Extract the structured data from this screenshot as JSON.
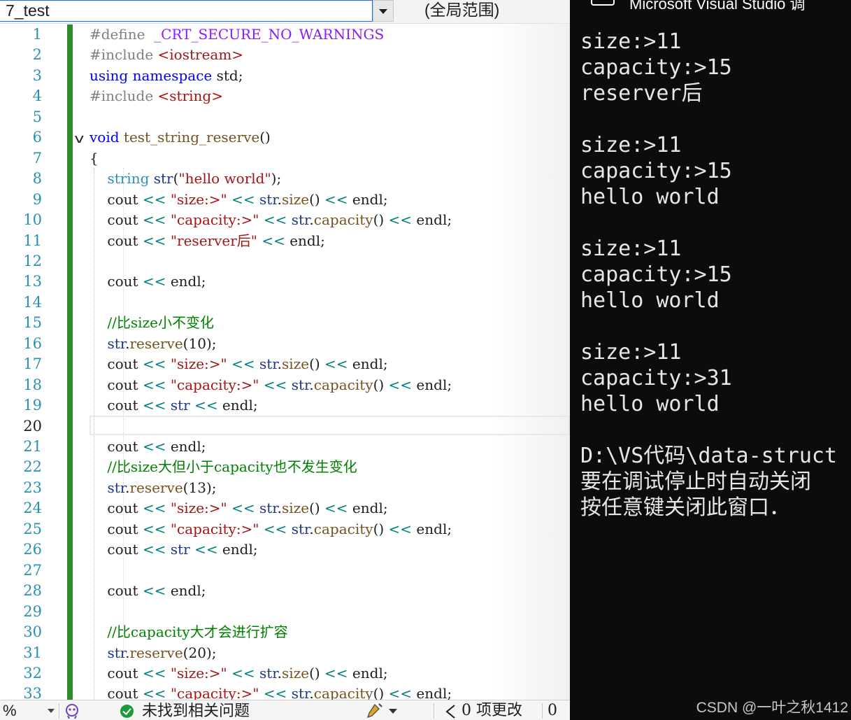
{
  "toolbar": {
    "project_name": "7_test",
    "scope": "(全局范围)"
  },
  "editor": {
    "current_line": "20",
    "line_numbers": [
      "1",
      "2",
      "3",
      "4",
      "5",
      "6",
      "7",
      "8",
      "9",
      "10",
      "11",
      "12",
      "13",
      "14",
      "15",
      "16",
      "17",
      "18",
      "19",
      "20",
      "21",
      "22",
      "23",
      "24",
      "25",
      "26",
      "27",
      "28",
      "29",
      "30",
      "31",
      "32",
      "33"
    ],
    "lines": [
      [
        [
          "pp",
          "#define  "
        ],
        [
          "macro",
          "_CRT_SECURE_NO_WARNINGS"
        ]
      ],
      [
        [
          "pp",
          "#include "
        ],
        [
          "str",
          "<iostream>"
        ]
      ],
      [
        [
          "kw",
          "using"
        ],
        [
          "",
          " "
        ],
        [
          "kw",
          "namespace"
        ],
        [
          "",
          " std;"
        ]
      ],
      [
        [
          "pp",
          "#include "
        ],
        [
          "str",
          "<string>"
        ]
      ],
      [],
      [
        [
          "kw",
          "void"
        ],
        [
          "",
          " "
        ],
        [
          "fn",
          "test_string_reserve"
        ],
        [
          "",
          "()"
        ]
      ],
      [
        [
          "",
          "{"
        ]
      ],
      [
        [
          "",
          "    "
        ],
        [
          "ty",
          "string"
        ],
        [
          "",
          " "
        ],
        [
          "var",
          "str"
        ],
        [
          "",
          "("
        ],
        [
          "str",
          "\"hello world\""
        ],
        [
          "",
          ");"
        ]
      ],
      [
        [
          "",
          "    cout "
        ],
        [
          "op",
          "<<"
        ],
        [
          "",
          " "
        ],
        [
          "str",
          "\"size:>\""
        ],
        [
          "",
          " "
        ],
        [
          "op",
          "<<"
        ],
        [
          "",
          " "
        ],
        [
          "var",
          "str"
        ],
        [
          "",
          "."
        ],
        [
          "fn",
          "size"
        ],
        [
          "",
          "() "
        ],
        [
          "op",
          "<<"
        ],
        [
          "",
          " endl;"
        ]
      ],
      [
        [
          "",
          "    cout "
        ],
        [
          "op",
          "<<"
        ],
        [
          "",
          " "
        ],
        [
          "str",
          "\"capacity:>\""
        ],
        [
          "",
          " "
        ],
        [
          "op",
          "<<"
        ],
        [
          "",
          " "
        ],
        [
          "var",
          "str"
        ],
        [
          "",
          "."
        ],
        [
          "fn",
          "capacity"
        ],
        [
          "",
          "() "
        ],
        [
          "op",
          "<<"
        ],
        [
          "",
          " endl;"
        ]
      ],
      [
        [
          "",
          "    cout "
        ],
        [
          "op",
          "<<"
        ],
        [
          "",
          " "
        ],
        [
          "str",
          "\"reserver后\""
        ],
        [
          "",
          " "
        ],
        [
          "op",
          "<<"
        ],
        [
          "",
          " endl;"
        ]
      ],
      [],
      [
        [
          "",
          "    cout "
        ],
        [
          "op",
          "<<"
        ],
        [
          "",
          " endl;"
        ]
      ],
      [],
      [
        [
          "",
          "    "
        ],
        [
          "cm",
          "//比size小不变化"
        ]
      ],
      [
        [
          "",
          "    "
        ],
        [
          "var",
          "str"
        ],
        [
          "",
          "."
        ],
        [
          "fn",
          "reserve"
        ],
        [
          "",
          "("
        ],
        [
          "",
          "10"
        ],
        [
          "",
          ");"
        ]
      ],
      [
        [
          "",
          "    cout "
        ],
        [
          "op",
          "<<"
        ],
        [
          "",
          " "
        ],
        [
          "str",
          "\"size:>\""
        ],
        [
          "",
          " "
        ],
        [
          "op",
          "<<"
        ],
        [
          "",
          " "
        ],
        [
          "var",
          "str"
        ],
        [
          "",
          "."
        ],
        [
          "fn",
          "size"
        ],
        [
          "",
          "() "
        ],
        [
          "op",
          "<<"
        ],
        [
          "",
          " endl;"
        ]
      ],
      [
        [
          "",
          "    cout "
        ],
        [
          "op",
          "<<"
        ],
        [
          "",
          " "
        ],
        [
          "str",
          "\"capacity:>\""
        ],
        [
          "",
          " "
        ],
        [
          "op",
          "<<"
        ],
        [
          "",
          " "
        ],
        [
          "var",
          "str"
        ],
        [
          "",
          "."
        ],
        [
          "fn",
          "capacity"
        ],
        [
          "",
          "() "
        ],
        [
          "op",
          "<<"
        ],
        [
          "",
          " endl;"
        ]
      ],
      [
        [
          "",
          "    cout "
        ],
        [
          "op",
          "<<"
        ],
        [
          "",
          " "
        ],
        [
          "var",
          "str"
        ],
        [
          "",
          " "
        ],
        [
          "op",
          "<<"
        ],
        [
          "",
          " endl;"
        ]
      ],
      [],
      [
        [
          "",
          "    cout "
        ],
        [
          "op",
          "<<"
        ],
        [
          "",
          " endl;"
        ]
      ],
      [
        [
          "",
          "    "
        ],
        [
          "cm",
          "//比size大但小于capacity也不发生变化"
        ]
      ],
      [
        [
          "",
          "    "
        ],
        [
          "var",
          "str"
        ],
        [
          "",
          "."
        ],
        [
          "fn",
          "reserve"
        ],
        [
          "",
          "("
        ],
        [
          "",
          "13"
        ],
        [
          "",
          ");"
        ]
      ],
      [
        [
          "",
          "    cout "
        ],
        [
          "op",
          "<<"
        ],
        [
          "",
          " "
        ],
        [
          "str",
          "\"size:>\""
        ],
        [
          "",
          " "
        ],
        [
          "op",
          "<<"
        ],
        [
          "",
          " "
        ],
        [
          "var",
          "str"
        ],
        [
          "",
          "."
        ],
        [
          "fn",
          "size"
        ],
        [
          "",
          "() "
        ],
        [
          "op",
          "<<"
        ],
        [
          "",
          " endl;"
        ]
      ],
      [
        [
          "",
          "    cout "
        ],
        [
          "op",
          "<<"
        ],
        [
          "",
          " "
        ],
        [
          "str",
          "\"capacity:>\""
        ],
        [
          "",
          " "
        ],
        [
          "op",
          "<<"
        ],
        [
          "",
          " "
        ],
        [
          "var",
          "str"
        ],
        [
          "",
          "."
        ],
        [
          "fn",
          "capacity"
        ],
        [
          "",
          "() "
        ],
        [
          "op",
          "<<"
        ],
        [
          "",
          " endl;"
        ]
      ],
      [
        [
          "",
          "    cout "
        ],
        [
          "op",
          "<<"
        ],
        [
          "",
          " "
        ],
        [
          "var",
          "str"
        ],
        [
          "",
          " "
        ],
        [
          "op",
          "<<"
        ],
        [
          "",
          " endl;"
        ]
      ],
      [],
      [
        [
          "",
          "    cout "
        ],
        [
          "op",
          "<<"
        ],
        [
          "",
          " endl;"
        ]
      ],
      [],
      [
        [
          "",
          "    "
        ],
        [
          "cm",
          "//比capacity大才会进行扩容"
        ]
      ],
      [
        [
          "",
          "    "
        ],
        [
          "var",
          "str"
        ],
        [
          "",
          "."
        ],
        [
          "fn",
          "reserve"
        ],
        [
          "",
          "("
        ],
        [
          "",
          "20"
        ],
        [
          "",
          ");"
        ]
      ],
      [
        [
          "",
          "    cout "
        ],
        [
          "op",
          "<<"
        ],
        [
          "",
          " "
        ],
        [
          "str",
          "\"size:>\""
        ],
        [
          "",
          " "
        ],
        [
          "op",
          "<<"
        ],
        [
          "",
          " "
        ],
        [
          "var",
          "str"
        ],
        [
          "",
          "."
        ],
        [
          "fn",
          "size"
        ],
        [
          "",
          "() "
        ],
        [
          "op",
          "<<"
        ],
        [
          "",
          " endl;"
        ]
      ],
      [
        [
          "",
          "    cout "
        ],
        [
          "op",
          "<<"
        ],
        [
          "",
          " "
        ],
        [
          "str",
          "\"capacity:>\""
        ],
        [
          "",
          " "
        ],
        [
          "op",
          "<<"
        ],
        [
          "",
          " "
        ],
        [
          "var",
          "str"
        ],
        [
          "",
          "."
        ],
        [
          "fn",
          "capacity"
        ],
        [
          "",
          "() "
        ],
        [
          "op",
          "<<"
        ],
        [
          "",
          " endl;"
        ]
      ]
    ]
  },
  "statusbar": {
    "zoom": "%",
    "issues_text": "未找到相关问题",
    "changes_text": "0 项更改",
    "changes_extra": "0"
  },
  "console": {
    "title": "Microsoft Visual Studio 调",
    "lines": [
      "size:>11",
      "capacity:>15",
      "reserver后",
      "",
      "size:>11",
      "capacity:>15",
      "hello world",
      "",
      "size:>11",
      "capacity:>15",
      "hello world",
      "",
      "size:>11",
      "capacity:>31",
      "hello world",
      "",
      "D:\\VS代码\\data-struct",
      "要在调试停止时自动关闭",
      "按任意键关闭此窗口．"
    ],
    "watermark": "CSDN @一叶之秋1412"
  },
  "colors": {
    "keyword": "#0000ff",
    "string": "#a31515",
    "comment": "#008000",
    "type": "#2b91af",
    "console_bg": "#0c0c0c",
    "change_bar": "#2e8b2e"
  },
  "icons": [
    "dropdown-arrow-icon",
    "fold-chevron-icon",
    "copilot-icon",
    "check-circle-icon",
    "cleanup-brush-icon",
    "console-window-icon"
  ]
}
